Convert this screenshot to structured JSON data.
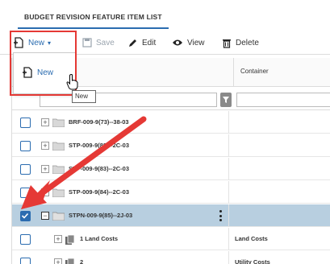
{
  "tab": {
    "label": "BUDGET REVISION FEATURE ITEM LIST"
  },
  "toolbar": {
    "new_label": "New",
    "save_label": "Save",
    "edit_label": "Edit",
    "view_label": "View",
    "delete_label": "Delete"
  },
  "dropdown": {
    "new_item_label": "New",
    "tooltip": "New"
  },
  "grid": {
    "container_header": "Container",
    "rows": [
      {
        "name": "BRF-009-9(73)--38-03",
        "container": "",
        "checked": false,
        "selected": false
      },
      {
        "name": "STP-009-9(82)--2C-03",
        "container": "",
        "checked": false,
        "selected": false
      },
      {
        "name": "STP-009-9(83)--2C-03",
        "container": "",
        "checked": false,
        "selected": false
      },
      {
        "name": "STP-009-9(84)--2C-03",
        "container": "",
        "checked": false,
        "selected": false
      },
      {
        "name": "STPN-009-9(85)--2J-03",
        "container": "",
        "checked": true,
        "selected": true
      },
      {
        "name": "1 Land Costs",
        "container": "Land Costs",
        "checked": false,
        "selected": false
      },
      {
        "name": "2",
        "container": "Utility Costs",
        "checked": false,
        "selected": false
      }
    ]
  },
  "colors": {
    "accent": "#2b6cb0",
    "selected_row": "#b8cfe0",
    "annotation": "#e53935"
  }
}
